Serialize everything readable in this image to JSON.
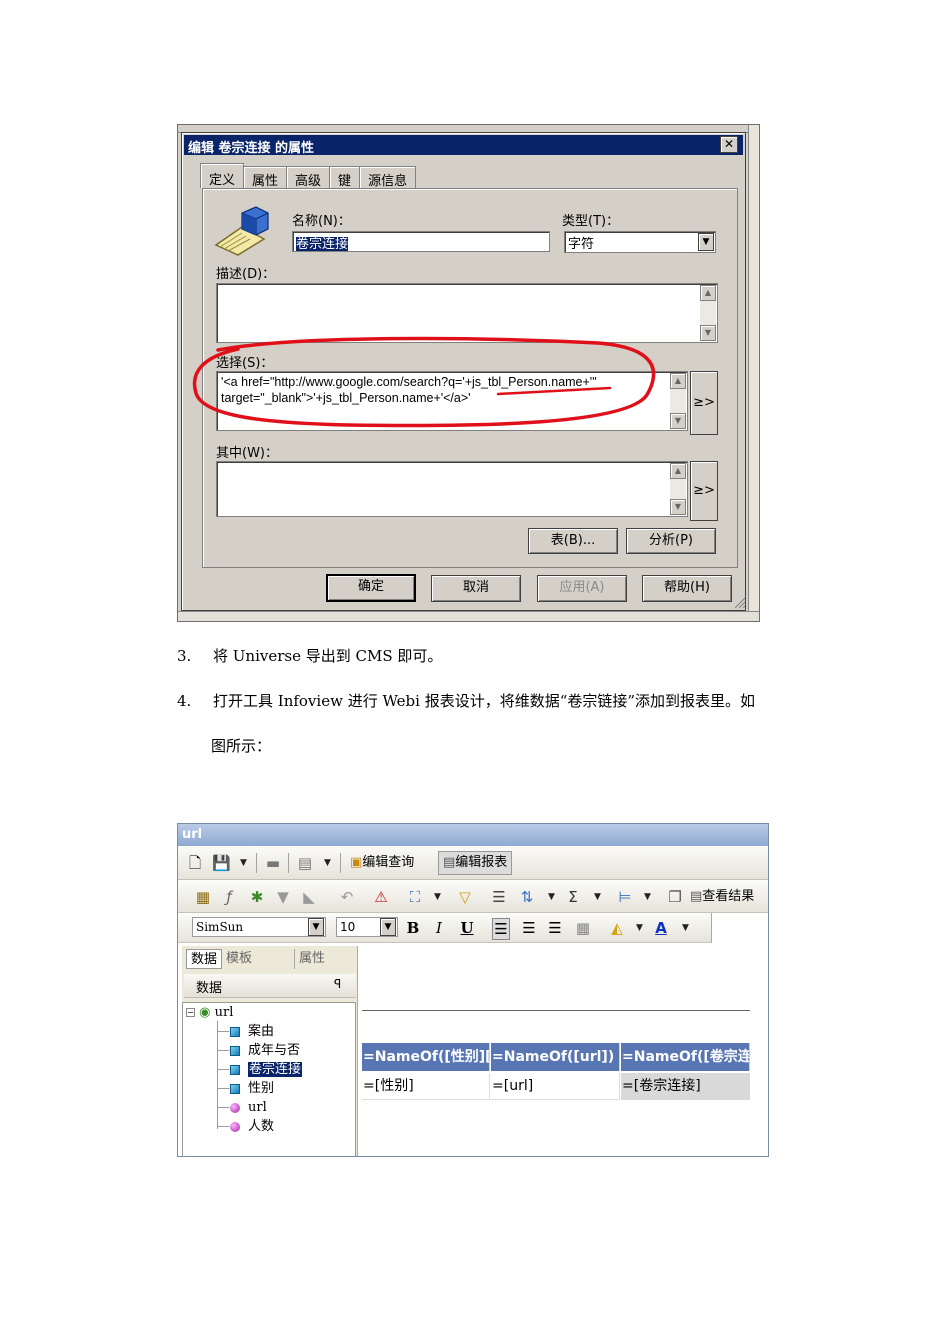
{
  "dialog": {
    "title": "编辑 卷宗连接 的属性",
    "close_glyph": "✕",
    "tabs": [
      "定义",
      "属性",
      "高级",
      "键",
      "源信息"
    ],
    "name_label": "名称(N)：",
    "name_value": "卷宗连接",
    "type_label": "类型(T)：",
    "type_value": "字符",
    "desc_label": "描述(D)：",
    "select_label": "选择(S)：",
    "select_line1": "'<a href=\"http://www.google.com/search?q='+js_tbl_Person.name+'\"",
    "select_line2": "target=\"_blank\">'+js_tbl_Person.name+'</a>'",
    "expand_button": "≥>",
    "where_label": "其中(W)：",
    "tables_button": "表(B)...",
    "parse_button": "分析(P)",
    "ok_button": "确定",
    "cancel_button": "取消",
    "apply_button": "应用(A)",
    "help_button": "帮助(H)",
    "annotation_color": "#e0101a"
  },
  "steps": [
    {
      "num": "3.",
      "text": "将 Universe 导出到 CMS 即可。"
    },
    {
      "num": "4.",
      "text": "打开工具 Infoview 进行 Webi 报表设计，将维数据“卷宗链接”添加到报表里。如"
    },
    {
      "num": "",
      "text": "图所示："
    }
  ],
  "webi": {
    "title": "url",
    "edit_query": "编辑查询",
    "edit_report": "编辑报表",
    "view_results": "查看结果",
    "font_name": "SimSun",
    "font_size": "10",
    "bold": "B",
    "italic": "I",
    "underline": "U",
    "sigma": "Σ",
    "font_color_glyph": "A",
    "panel_tabs": [
      "数据",
      "模板",
      "属性"
    ],
    "panel_title": "数据",
    "pin_glyph": "ꟼ",
    "tree_root": "url",
    "tree_items": [
      {
        "label": "案由",
        "kind": "dimension"
      },
      {
        "label": "成年与否",
        "kind": "dimension"
      },
      {
        "label": "卷宗连接",
        "kind": "dimension",
        "selected": true
      },
      {
        "label": "性别",
        "kind": "dimension"
      },
      {
        "label": "url",
        "kind": "measure"
      },
      {
        "label": "人数",
        "kind": "measure"
      }
    ],
    "table_headers": [
      "=NameOf([性别][",
      "=NameOf([url])",
      "=NameOf([卷宗连"
    ],
    "table_row": [
      "=[性别]",
      "=[url]",
      "=[卷宗连接]"
    ],
    "header_color": "#5876b4"
  }
}
